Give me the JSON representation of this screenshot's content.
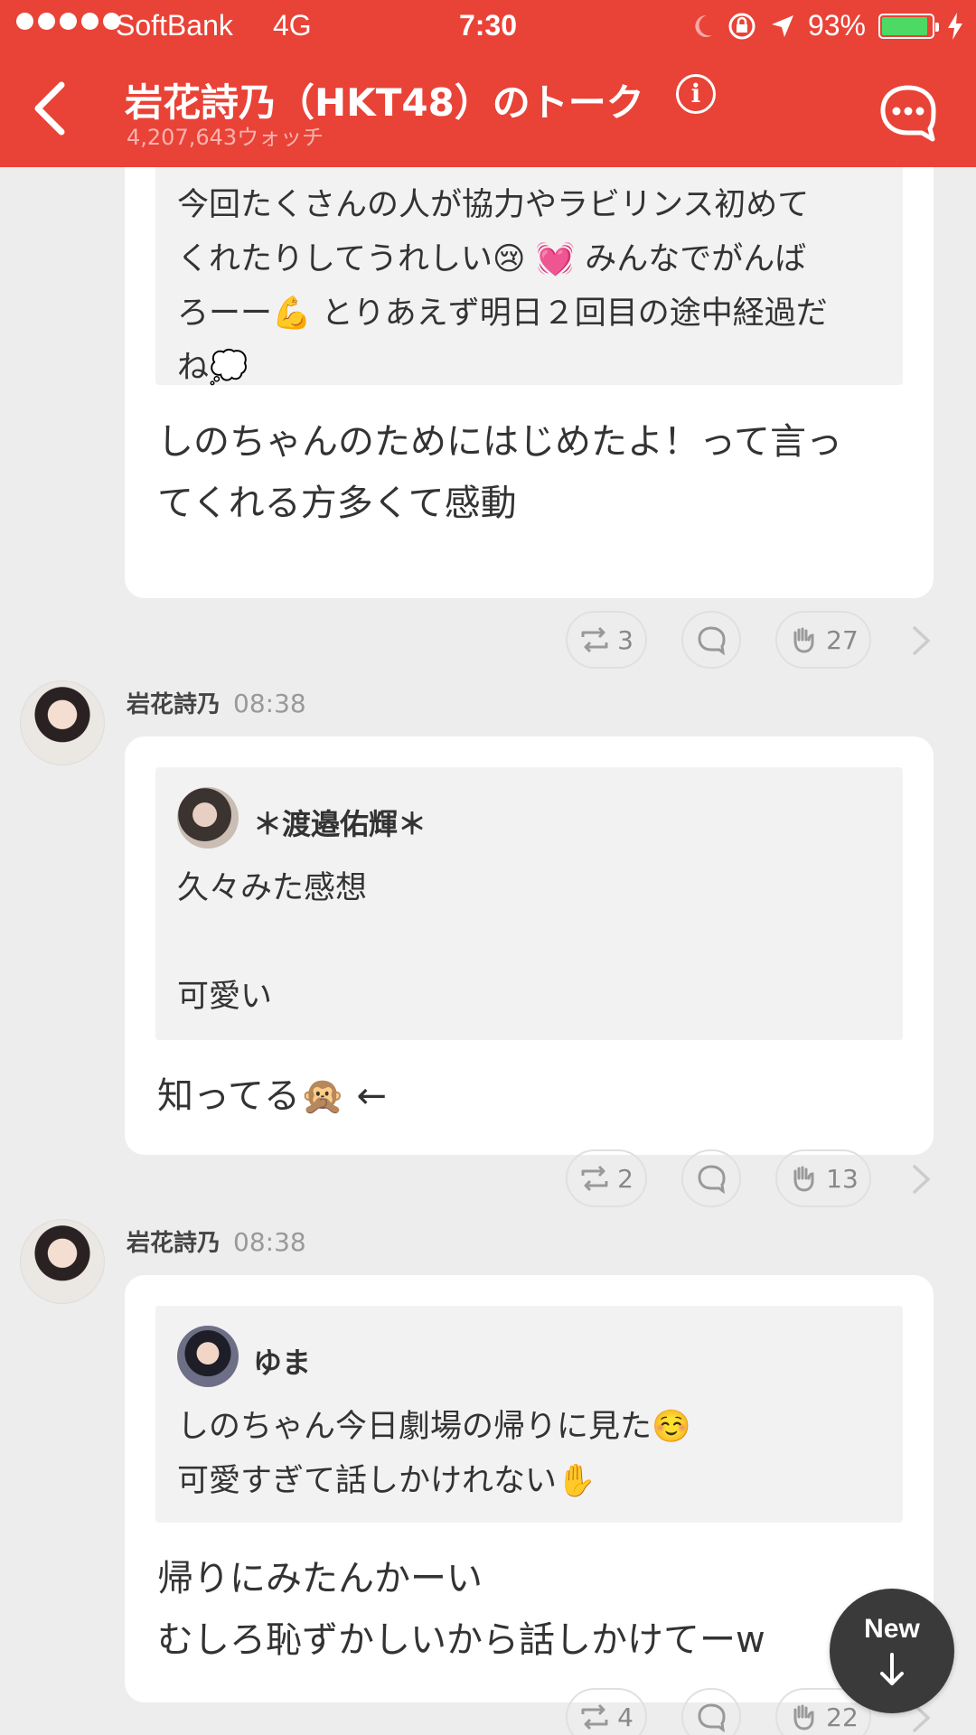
{
  "status_bar": {
    "carrier": "SoftBank",
    "network": "4G",
    "time": "7:30",
    "battery": "93%",
    "battery_level": 0.93,
    "icons": [
      "moon-icon",
      "rotation-lock-icon",
      "location-arrow-icon",
      "charging-bolt-icon"
    ]
  },
  "header": {
    "title": "岩花詩乃（HKT48）のトーク",
    "watch_count": "4,207,643ウォッチ",
    "colors": {
      "bar": "#e94237"
    }
  },
  "posts": [
    {
      "quote": {
        "text": "今回たくさんの人が協力やラビリンス初めて\nくれたりしてうれしい😢 💓 みんなでがんば\nろーー💪 とりあえず明日２回目の途中経過だ\nね💭"
      },
      "body": "しのちゃんのためにはじめたよ！って言っ\nてくれる方多くて感動",
      "actions": {
        "retweets": "3",
        "claps": "27"
      }
    },
    {
      "author": "岩花詩乃",
      "time": "08:38",
      "quote": {
        "name": "＊渡邉佑輝＊",
        "text": "久々みた感想\n\n可愛い"
      },
      "body": "知ってる🙊 ←",
      "actions": {
        "retweets": "2",
        "claps": "13"
      }
    },
    {
      "author": "岩花詩乃",
      "time": "08:38",
      "quote": {
        "name": "ゆま",
        "text": "しのちゃん今日劇場の帰りに見た☺️\n可愛すぎて話しかけれない✋"
      },
      "body": "帰りにみたんかーい\nむしろ恥ずかしいから話しかけてーw",
      "actions": {
        "retweets": "4",
        "claps": "22"
      }
    }
  ],
  "new_button": {
    "label": "New"
  }
}
